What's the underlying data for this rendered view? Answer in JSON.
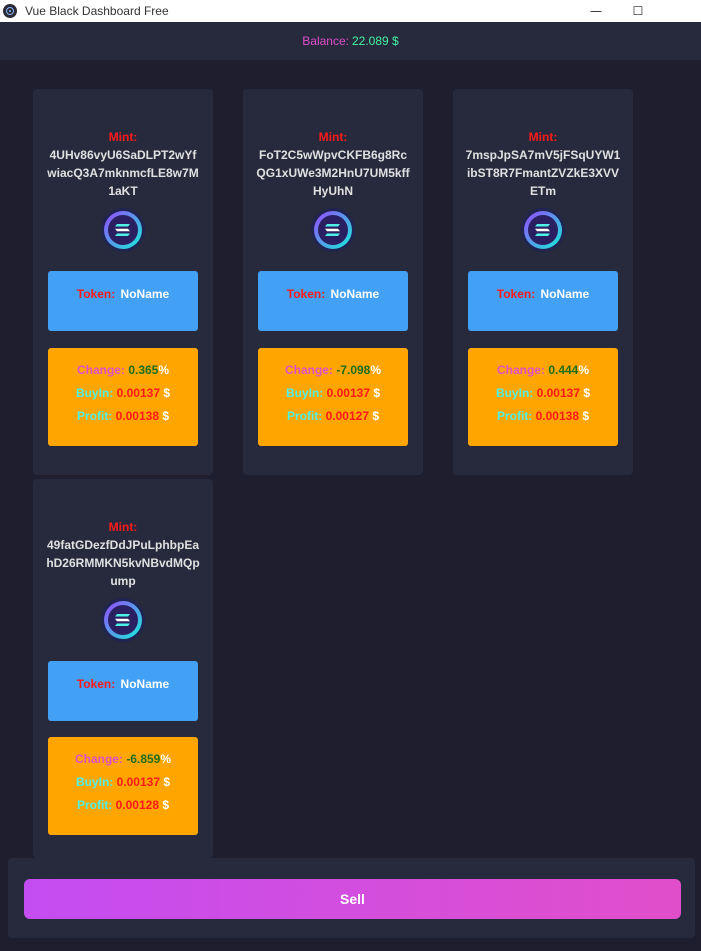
{
  "window": {
    "title": "Vue Black Dashboard Free"
  },
  "balance": {
    "label": "Balance:",
    "value": "22.089 $"
  },
  "cards": [
    {
      "mint_label": "Mint:",
      "mint_address": "4UHv86vyU6SaDLPT2wYfwiacQ3A7mknmcfLE8w7M1aKT",
      "token_label": "Token:",
      "token_value": "NoName",
      "change_label": "Change:",
      "change_value": "0.365",
      "change_unit": "%",
      "buyin_label": "BuyIn:",
      "buyin_value": "0.00137",
      "buyin_unit": "$",
      "profit_label": "Profit:",
      "profit_value": "0.00138",
      "profit_unit": "$"
    },
    {
      "mint_label": "Mint:",
      "mint_address": "FoT2C5wWpvCKFB6g8RcQG1xUWe3M2HnU7UM5kffHyUhN",
      "token_label": "Token:",
      "token_value": "NoName",
      "change_label": "Change:",
      "change_value": "-7.098",
      "change_unit": "%",
      "buyin_label": "BuyIn:",
      "buyin_value": "0.00137",
      "buyin_unit": "$",
      "profit_label": "Profit:",
      "profit_value": "0.00127",
      "profit_unit": "$"
    },
    {
      "mint_label": "Mint:",
      "mint_address": "7mspJpSA7mV5jFSqUYW1ibST8R7FmantZVZkE3XVVETm",
      "token_label": "Token:",
      "token_value": "NoName",
      "change_label": "Change:",
      "change_value": "0.444",
      "change_unit": "%",
      "buyin_label": "BuyIn:",
      "buyin_value": "0.00137",
      "buyin_unit": "$",
      "profit_label": "Profit:",
      "profit_value": "0.00138",
      "profit_unit": "$"
    },
    {
      "mint_label": "Mint:",
      "mint_address": "49fatGDezfDdJPuLphbpEahD26RMMKN5kvNBvdMQpump",
      "token_label": "Token:",
      "token_value": "NoName",
      "change_label": "Change:",
      "change_value": "-6.859",
      "change_unit": "%",
      "buyin_label": "BuyIn:",
      "buyin_value": "0.00137",
      "buyin_unit": "$",
      "profit_label": "Profit:",
      "profit_value": "0.00128",
      "profit_unit": "$"
    }
  ],
  "sell_button": {
    "label": "Sell"
  },
  "icons": {
    "app": "vue-app-icon",
    "token": "solana-logo-icon"
  },
  "colors": {
    "background": "#1e1e2f",
    "card": "#27293d",
    "token_box": "#42a0f5",
    "stats_box": "#ffa500",
    "accent": "#e14eca"
  }
}
